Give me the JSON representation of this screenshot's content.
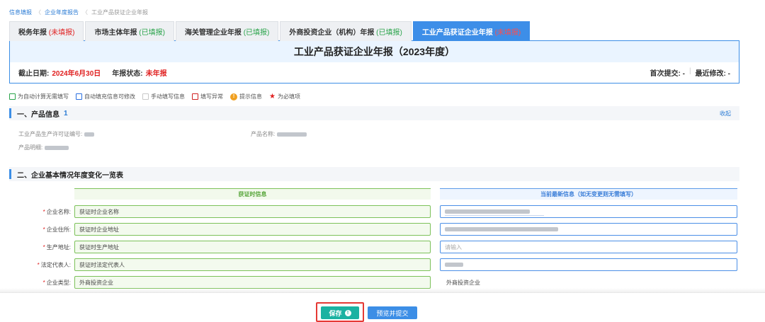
{
  "breadcrumb": [
    "信息填报",
    "企业年度报告",
    "工业产品获证企业年报"
  ],
  "tabs": [
    {
      "name": "税务年报",
      "status": "(未填报)",
      "status_color": "red"
    },
    {
      "name": "市场主体年报",
      "status": "(已填报)",
      "status_color": "green"
    },
    {
      "name": "海关管理企业年报",
      "status": "(已填报)",
      "status_color": "green"
    },
    {
      "name": "外商投资企业（机构）年报",
      "status": "(已填报)",
      "status_color": "green"
    },
    {
      "name": "工业产品获证企业年报",
      "status": "(未填报)",
      "status_color": "red",
      "active": true
    }
  ],
  "report_title": "工业产品获证企业年报（2023年度）",
  "info": {
    "deadline_label": "截止日期:",
    "deadline_value": "2024年6月30日",
    "status_label": "年报状态:",
    "status_value": "未年报",
    "first_submit": "首次提交: -",
    "last_modify": "最近修改: -"
  },
  "legend": {
    "auto_calc": "为自动计算无需填写",
    "auto_fill": "自动填充信息可修改",
    "manual": "手动填写信息",
    "error": "填写异常",
    "hint": "提示信息",
    "required": "为必填项"
  },
  "section1": {
    "title": "一、产品信息",
    "count": "1",
    "collapse": "收起",
    "license_label": "工业产品生产许可证编号:",
    "product_name_label": "产品名称:",
    "product_detail_label": "产品明细:"
  },
  "section2": {
    "title": "二、企业基本情况年度变化一览表",
    "col_cert": "获证时信息",
    "col_current": "当前最新信息（如无变更则无需填写）",
    "rows": [
      {
        "label": "企业名称:",
        "cert": "获证时企业名称",
        "current": ""
      },
      {
        "label": "企业住所:",
        "cert": "获证时企业地址",
        "current": ""
      },
      {
        "label": "生产地址:",
        "cert": "获证时生产地址",
        "current_placeholder": "请输入"
      },
      {
        "label": "法定代表人:",
        "cert": "获证时法定代表人",
        "current": ""
      },
      {
        "label": "企业类型:",
        "cert": "外商投资企业",
        "current_text": "外商投资企业"
      }
    ]
  },
  "footer": {
    "save": "保存",
    "preview_submit": "预览并提交"
  },
  "colors": {
    "accent_blue": "#3c8ee6",
    "green": "#7cc15a",
    "red": "#e02020",
    "save_teal": "#1bb2a2"
  }
}
